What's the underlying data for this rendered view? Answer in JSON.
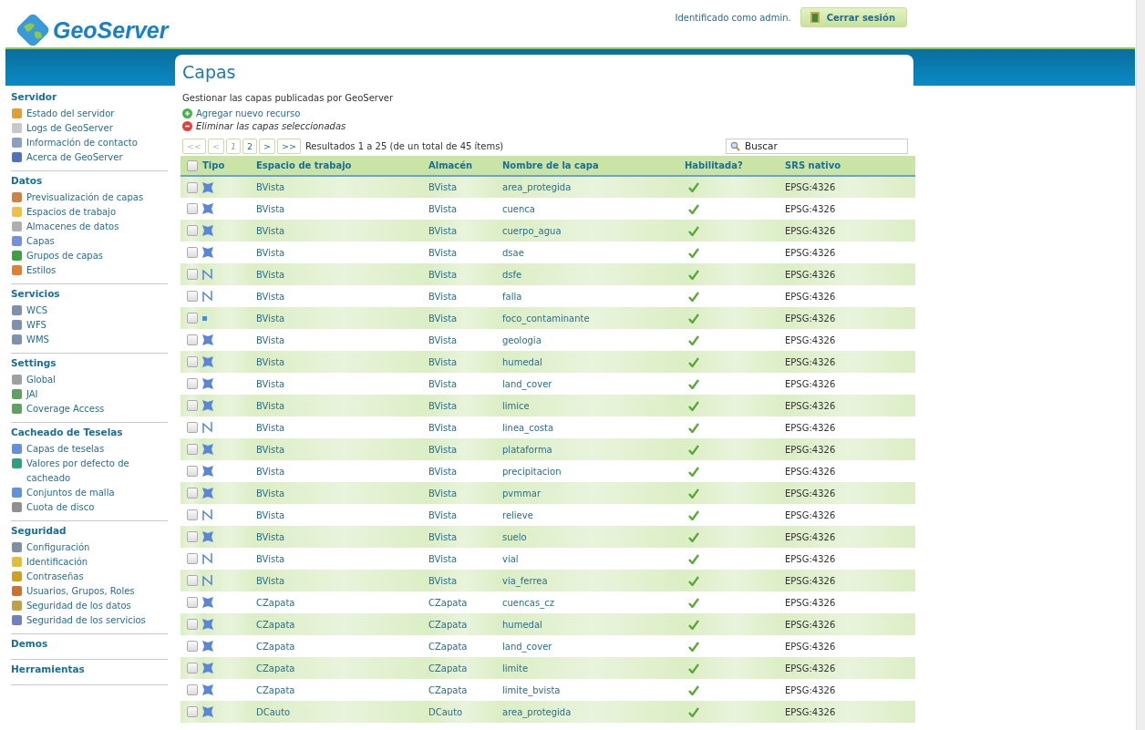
{
  "header": {
    "logo": "GeoServer",
    "user_text": "Identificado como admin.",
    "logout_button": "Cerrar sesión"
  },
  "sidebar": [
    {
      "title": "Servidor",
      "items": [
        "Estado del servidor",
        "Logs de GeoServer",
        "Información de contacto",
        "Acerca de GeoServer"
      ]
    },
    {
      "title": "Datos",
      "items": [
        "Previsualización de capas",
        "Espacios de trabajo",
        "Almacenes de datos",
        "Capas",
        "Grupos de capas",
        "Estilos"
      ]
    },
    {
      "title": "Servicios",
      "items": [
        "WCS",
        "WFS",
        "WMS"
      ]
    },
    {
      "title": "Settings",
      "items": [
        "Global",
        "JAI",
        "Coverage Access"
      ]
    },
    {
      "title": "Cacheado de Teselas",
      "items": [
        "Capas de teselas",
        "Valores por defecto de cacheado",
        "Conjuntos de malla",
        "Cuota de disco"
      ]
    },
    {
      "title": "Seguridad",
      "items": [
        "Configuración",
        "Identificación",
        "Contraseñas",
        "Usuarios, Grupos, Roles",
        "Seguridad de los datos",
        "Seguridad de los servicios"
      ]
    },
    {
      "title": "Demos"
    },
    {
      "title": "Herramientas"
    }
  ],
  "page": {
    "title": "Capas",
    "description": "Gestionar las capas publicadas por GeoServer",
    "add_link": "Agregar nuevo recurso",
    "remove_link": "Eliminar las capas seleccionadas"
  },
  "pager": {
    "buttons": [
      {
        "label": "<<",
        "disabled": true,
        "selected": false
      },
      {
        "label": "<",
        "disabled": true,
        "selected": false
      },
      {
        "label": "1",
        "disabled": false,
        "selected": true
      },
      {
        "label": "2",
        "disabled": false,
        "selected": false
      },
      {
        "label": ">",
        "disabled": false,
        "selected": false
      },
      {
        "label": ">>",
        "disabled": false,
        "selected": false
      }
    ],
    "summary": "Resultados 1 a 25 (de un total de 45 ítems)"
  },
  "search": {
    "placeholder": "Buscar"
  },
  "table": {
    "header_checked": false,
    "columns": [
      "Tipo",
      "Espacio de trabajo",
      "Almacén",
      "Nombre de la capa",
      "Habilitada?",
      "SRS nativo"
    ],
    "rows": [
      {
        "kind": "polygon",
        "checked": false,
        "workspace": "BVista",
        "store": "BVista",
        "name": "area_protegida",
        "enabled": true,
        "srs": "EPSG:4326"
      },
      {
        "kind": "polygon",
        "checked": false,
        "workspace": "BVista",
        "store": "BVista",
        "name": "cuenca",
        "enabled": true,
        "srs": "EPSG:4326"
      },
      {
        "kind": "polygon",
        "checked": false,
        "workspace": "BVista",
        "store": "BVista",
        "name": "cuerpo_agua",
        "enabled": true,
        "srs": "EPSG:4326"
      },
      {
        "kind": "polygon",
        "checked": false,
        "workspace": "BVista",
        "store": "BVista",
        "name": "dsae",
        "enabled": true,
        "srs": "EPSG:4326"
      },
      {
        "kind": "line",
        "checked": false,
        "workspace": "BVista",
        "store": "BVista",
        "name": "dsfe",
        "enabled": true,
        "srs": "EPSG:4326"
      },
      {
        "kind": "line",
        "checked": false,
        "workspace": "BVista",
        "store": "BVista",
        "name": "falla",
        "enabled": true,
        "srs": "EPSG:4326"
      },
      {
        "kind": "point",
        "checked": false,
        "workspace": "BVista",
        "store": "BVista",
        "name": "foco_contaminante",
        "enabled": true,
        "srs": "EPSG:4326"
      },
      {
        "kind": "polygon",
        "checked": false,
        "workspace": "BVista",
        "store": "BVista",
        "name": "geologia",
        "enabled": true,
        "srs": "EPSG:4326"
      },
      {
        "kind": "polygon",
        "checked": false,
        "workspace": "BVista",
        "store": "BVista",
        "name": "humedal",
        "enabled": true,
        "srs": "EPSG:4326"
      },
      {
        "kind": "polygon",
        "checked": false,
        "workspace": "BVista",
        "store": "BVista",
        "name": "land_cover",
        "enabled": true,
        "srs": "EPSG:4326"
      },
      {
        "kind": "polygon",
        "checked": false,
        "workspace": "BVista",
        "store": "BVista",
        "name": "limice",
        "enabled": true,
        "srs": "EPSG:4326"
      },
      {
        "kind": "line",
        "checked": false,
        "workspace": "BVista",
        "store": "BVista",
        "name": "linea_costa",
        "enabled": true,
        "srs": "EPSG:4326"
      },
      {
        "kind": "polygon",
        "checked": false,
        "workspace": "BVista",
        "store": "BVista",
        "name": "plataforma",
        "enabled": true,
        "srs": "EPSG:4326"
      },
      {
        "kind": "polygon",
        "checked": false,
        "workspace": "BVista",
        "store": "BVista",
        "name": "precipitacion",
        "enabled": true,
        "srs": "EPSG:4326"
      },
      {
        "kind": "polygon",
        "checked": false,
        "workspace": "BVista",
        "store": "BVista",
        "name": "pvmmar",
        "enabled": true,
        "srs": "EPSG:4326"
      },
      {
        "kind": "line",
        "checked": false,
        "workspace": "BVista",
        "store": "BVista",
        "name": "relieve",
        "enabled": true,
        "srs": "EPSG:4326"
      },
      {
        "kind": "polygon",
        "checked": false,
        "workspace": "BVista",
        "store": "BVista",
        "name": "suelo",
        "enabled": true,
        "srs": "EPSG:4326"
      },
      {
        "kind": "line",
        "checked": false,
        "workspace": "BVista",
        "store": "BVista",
        "name": "vial",
        "enabled": true,
        "srs": "EPSG:4326"
      },
      {
        "kind": "line",
        "checked": false,
        "workspace": "BVista",
        "store": "BVista",
        "name": "via_ferrea",
        "enabled": true,
        "srs": "EPSG:4326"
      },
      {
        "kind": "polygon",
        "checked": false,
        "workspace": "CZapata",
        "store": "CZapata",
        "name": "cuencas_cz",
        "enabled": true,
        "srs": "EPSG:4326"
      },
      {
        "kind": "polygon",
        "checked": false,
        "workspace": "CZapata",
        "store": "CZapata",
        "name": "humedal",
        "enabled": true,
        "srs": "EPSG:4326"
      },
      {
        "kind": "polygon",
        "checked": false,
        "workspace": "CZapata",
        "store": "CZapata",
        "name": "land_cover",
        "enabled": true,
        "srs": "EPSG:4326"
      },
      {
        "kind": "polygon",
        "checked": false,
        "workspace": "CZapata",
        "store": "CZapata",
        "name": "limite",
        "enabled": true,
        "srs": "EPSG:4326"
      },
      {
        "kind": "polygon",
        "checked": false,
        "workspace": "CZapata",
        "store": "CZapata",
        "name": "limite_bvista",
        "enabled": true,
        "srs": "EPSG:4326"
      },
      {
        "kind": "polygon",
        "checked": false,
        "workspace": "DCauto",
        "store": "DCauto",
        "name": "area_protegida",
        "enabled": true,
        "srs": "EPSG:4326"
      }
    ]
  }
}
